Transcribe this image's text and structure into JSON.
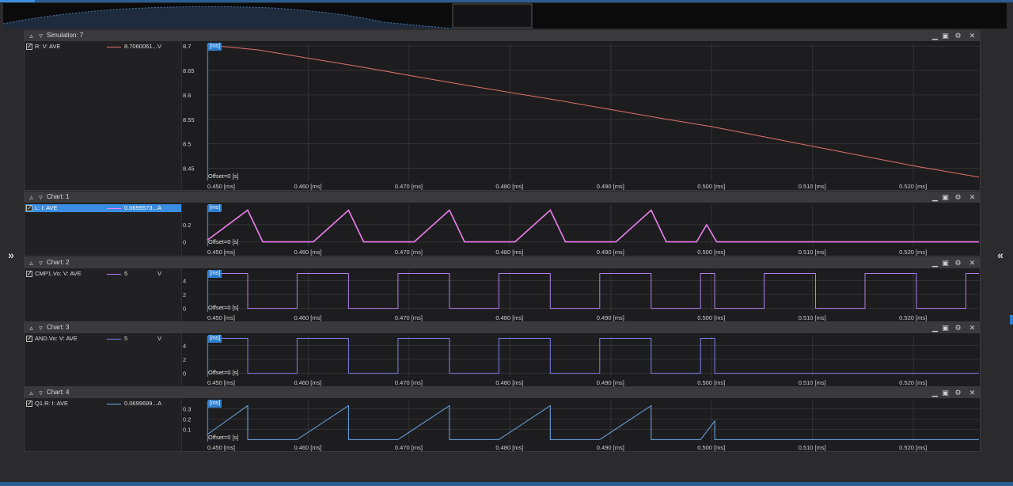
{
  "time_ticks": [
    "0.450 [ms]",
    "0.460 [ms]",
    "0.470 [ms]",
    "0.480 [ms]",
    "0.490 [ms]",
    "0.500 [ms]",
    "0.510 [ms]",
    "0.520 [ms]"
  ],
  "cursor_tag": "[ms]",
  "offset_label": "Offset=0 [s]",
  "icons": [
    "collapse-up-icon",
    "collapse-down-icon",
    "minimize-icon",
    "maximize-icon",
    "settings-icon",
    "close-icon",
    "expand-left-icon",
    "expand-right-icon"
  ],
  "panes": [
    {
      "title": "Simulation: 7",
      "legend": {
        "name": "R: V: AVE",
        "value": "8.7060061...",
        "unit": "V",
        "color": "#e0706a",
        "selected": false
      },
      "yticks": [
        "8.7",
        "8.65",
        "8.6",
        "8.55",
        "8.5",
        "8.45"
      ]
    },
    {
      "title": "Chart: 1",
      "legend": {
        "name": "L: I: AVE",
        "value": "0.0699573...",
        "unit": "A",
        "color": "#f07ff0",
        "selected": true
      },
      "yticks": [
        "0.2",
        "0"
      ]
    },
    {
      "title": "Chart: 2",
      "legend": {
        "name": "CMP1.Vo: V: AVE",
        "value": "5",
        "unit": "V",
        "color": "#b07fe8",
        "selected": false
      },
      "yticks": [
        "4",
        "2",
        "0"
      ]
    },
    {
      "title": "Chart: 3",
      "legend": {
        "name": "AND.Vo: V: AVE",
        "value": "5",
        "unit": "V",
        "color": "#7f7fe8",
        "selected": false
      },
      "yticks": [
        "4",
        "2",
        "0"
      ]
    },
    {
      "title": "Chart: 4",
      "legend": {
        "name": "Q1.R: I: AVE",
        "value": "0.0699699...",
        "unit": "A",
        "color": "#6fa8e8",
        "selected": false
      },
      "yticks": [
        "0.3",
        "0.2",
        "0.1"
      ]
    }
  ],
  "chart_data": [
    {
      "type": "line",
      "xlabel_unit": "ms",
      "xlim": [
        0.45,
        0.5265
      ],
      "ylim": [
        8.425,
        8.705
      ],
      "series": [
        {
          "name": "R: V: AVE",
          "x": [
            0.45,
            0.455,
            0.46,
            0.465,
            0.47,
            0.475,
            0.48,
            0.485,
            0.49,
            0.495,
            0.5,
            0.505,
            0.51,
            0.515,
            0.52,
            0.5265
          ],
          "y": [
            8.702,
            8.692,
            8.675,
            8.658,
            8.64,
            8.622,
            8.605,
            8.588,
            8.57,
            8.552,
            8.535,
            8.515,
            8.495,
            8.475,
            8.455,
            8.432
          ]
        }
      ]
    },
    {
      "type": "line",
      "xlim": [
        0.45,
        0.5265
      ],
      "ylim": [
        -0.05,
        0.43
      ],
      "series": [
        {
          "name": "L: I: AVE",
          "x": [
            0.45,
            0.454,
            0.4555,
            0.4585,
            0.4605,
            0.464,
            0.4655,
            0.4685,
            0.4705,
            0.474,
            0.4755,
            0.4785,
            0.4805,
            0.484,
            0.4855,
            0.4885,
            0.4905,
            0.494,
            0.4955,
            0.4985,
            0.4995,
            0.5005,
            0.5265
          ],
          "y": [
            0.02,
            0.37,
            0.0,
            0.0,
            0.0,
            0.37,
            0.0,
            0.0,
            0.0,
            0.37,
            0.0,
            0.0,
            0.0,
            0.37,
            0.0,
            0.0,
            0.0,
            0.37,
            0.0,
            0.0,
            0.2,
            0.0,
            0.0
          ]
        }
      ]
    },
    {
      "type": "line",
      "xlim": [
        0.45,
        0.5265
      ],
      "ylim": [
        -0.5,
        5.4
      ],
      "series": [
        {
          "name": "CMP1.Vo: V: AVE",
          "x": [
            0.45,
            0.454,
            0.454,
            0.4589,
            0.4589,
            0.464,
            0.464,
            0.4689,
            0.4689,
            0.474,
            0.474,
            0.4789,
            0.4789,
            0.484,
            0.484,
            0.4889,
            0.4889,
            0.494,
            0.494,
            0.4989,
            0.4989,
            0.5003,
            0.5003,
            0.5052,
            0.5052,
            0.5103,
            0.5103,
            0.5152,
            0.5152,
            0.5203,
            0.5203,
            0.5252,
            0.5252,
            0.5265
          ],
          "y": [
            5,
            5,
            0,
            0,
            5,
            5,
            0,
            0,
            5,
            5,
            0,
            0,
            5,
            5,
            0,
            0,
            5,
            5,
            0,
            0,
            5,
            5,
            0,
            0,
            5,
            5,
            0,
            0,
            5,
            5,
            0,
            0,
            5,
            5
          ]
        }
      ]
    },
    {
      "type": "line",
      "xlim": [
        0.45,
        0.5265
      ],
      "ylim": [
        -0.5,
        5.4
      ],
      "series": [
        {
          "name": "AND.Vo: V: AVE",
          "x": [
            0.45,
            0.454,
            0.454,
            0.4589,
            0.4589,
            0.464,
            0.464,
            0.4689,
            0.4689,
            0.474,
            0.474,
            0.4789,
            0.4789,
            0.484,
            0.484,
            0.4889,
            0.4889,
            0.494,
            0.494,
            0.4989,
            0.4989,
            0.5003,
            0.5003,
            0.5265
          ],
          "y": [
            5,
            5,
            0,
            0,
            5,
            5,
            0,
            0,
            5,
            5,
            0,
            0,
            5,
            5,
            0,
            0,
            5,
            5,
            0,
            0,
            5,
            5,
            0,
            0
          ]
        }
      ]
    },
    {
      "type": "line",
      "xlim": [
        0.45,
        0.5265
      ],
      "ylim": [
        -0.02,
        0.38
      ],
      "series": [
        {
          "name": "Q1.R: I: AVE",
          "x": [
            0.45,
            0.454,
            0.454,
            0.4589,
            0.464,
            0.464,
            0.4689,
            0.474,
            0.474,
            0.4789,
            0.484,
            0.484,
            0.4889,
            0.494,
            0.494,
            0.4989,
            0.5003,
            0.5003,
            0.5265
          ],
          "y": [
            0.05,
            0.33,
            0.0,
            0.0,
            0.33,
            0.0,
            0.0,
            0.33,
            0.0,
            0.0,
            0.33,
            0.0,
            0.0,
            0.33,
            0.0,
            0.0,
            0.18,
            0.0,
            0.0
          ]
        }
      ]
    }
  ]
}
